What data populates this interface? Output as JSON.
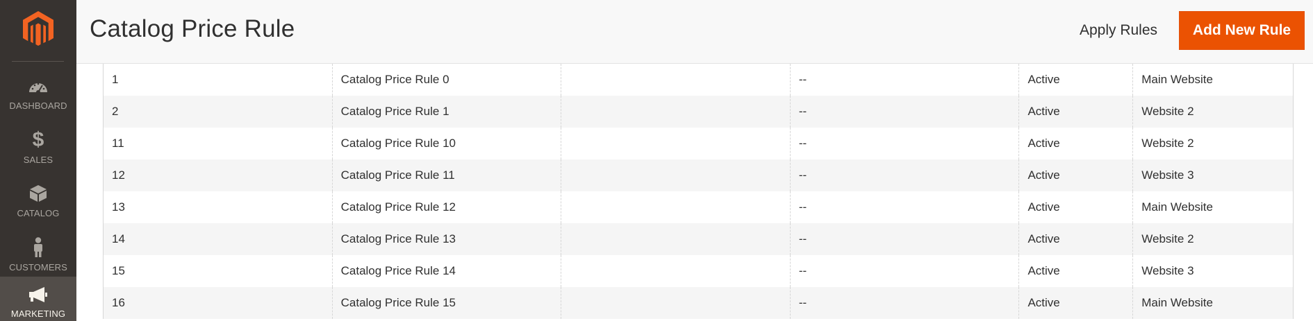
{
  "sidebar": {
    "logo": "magento-logo-icon",
    "items": [
      {
        "label": "DASHBOARD",
        "icon": "dashboard-gauge-icon"
      },
      {
        "label": "SALES",
        "icon": "dollar-icon"
      },
      {
        "label": "CATALOG",
        "icon": "box-icon"
      },
      {
        "label": "CUSTOMERS",
        "icon": "person-icon"
      },
      {
        "label": "MARKETING",
        "icon": "megaphone-icon",
        "active": true
      }
    ]
  },
  "header": {
    "title": "Catalog Price Rule",
    "apply_label": "Apply Rules",
    "add_label": "Add New Rule"
  },
  "colors": {
    "accent": "#eb5202",
    "sidebar_bg": "#373330",
    "sidebar_active_bg": "#524d49"
  },
  "grid": {
    "rows": [
      {
        "id": "1",
        "name": "Catalog Price Rule 0",
        "coupon": "",
        "date": "--",
        "status": "Active",
        "website": "Main Website"
      },
      {
        "id": "2",
        "name": "Catalog Price Rule 1",
        "coupon": "",
        "date": "--",
        "status": "Active",
        "website": "Website 2"
      },
      {
        "id": "11",
        "name": "Catalog Price Rule 10",
        "coupon": "",
        "date": "--",
        "status": "Active",
        "website": "Website 2"
      },
      {
        "id": "12",
        "name": "Catalog Price Rule 11",
        "coupon": "",
        "date": "--",
        "status": "Active",
        "website": "Website 3"
      },
      {
        "id": "13",
        "name": "Catalog Price Rule 12",
        "coupon": "",
        "date": "--",
        "status": "Active",
        "website": "Main Website"
      },
      {
        "id": "14",
        "name": "Catalog Price Rule 13",
        "coupon": "",
        "date": "--",
        "status": "Active",
        "website": "Website 2"
      },
      {
        "id": "15",
        "name": "Catalog Price Rule 14",
        "coupon": "",
        "date": "--",
        "status": "Active",
        "website": "Website 3"
      },
      {
        "id": "16",
        "name": "Catalog Price Rule 15",
        "coupon": "",
        "date": "--",
        "status": "Active",
        "website": "Main Website"
      }
    ]
  }
}
